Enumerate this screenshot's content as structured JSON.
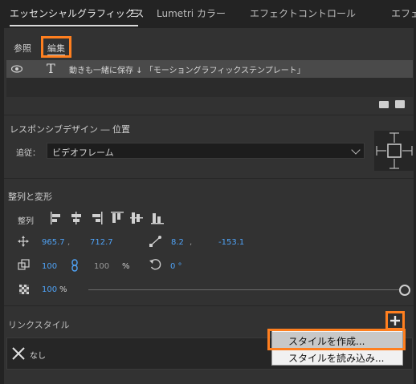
{
  "tabs": [
    {
      "label": "エッセンシャルグラフィックス",
      "active": true
    },
    {
      "label": "Lumetri カラー",
      "active": false
    },
    {
      "label": "エフェクトコントロール",
      "active": false
    },
    {
      "label": "エフェ",
      "active": false
    }
  ],
  "subtabs": {
    "browse": "参照",
    "edit": "編集"
  },
  "layer": {
    "text": "動きも一緒に保存 ↓ 「モーショングラフィックステンプレート」"
  },
  "responsive": {
    "title": "レスポンシブデザイン ― 位置",
    "follow_label": "追従：",
    "follow_value": "ビデオフレーム"
  },
  "align": {
    "title": "整列と変形",
    "align_label": "整列",
    "pos_x": "965.7",
    "pos_y": "712.7",
    "anchor_x": "8.2",
    "anchor_y": "-153.1",
    "scale_w": "100",
    "scale_h": "100",
    "percent": "%",
    "rotation": "0 °",
    "opacity": "100",
    "opacity_unit": "%",
    "opacity_level": 1.0
  },
  "link_style": {
    "title": "リンクスタイル",
    "none_label": "なし"
  },
  "menu": {
    "create": "スタイルを作成...",
    "load": "スタイルを読み込み..."
  },
  "colors": {
    "accent": "#4fa3f7",
    "highlight": "#ff7f1f"
  }
}
